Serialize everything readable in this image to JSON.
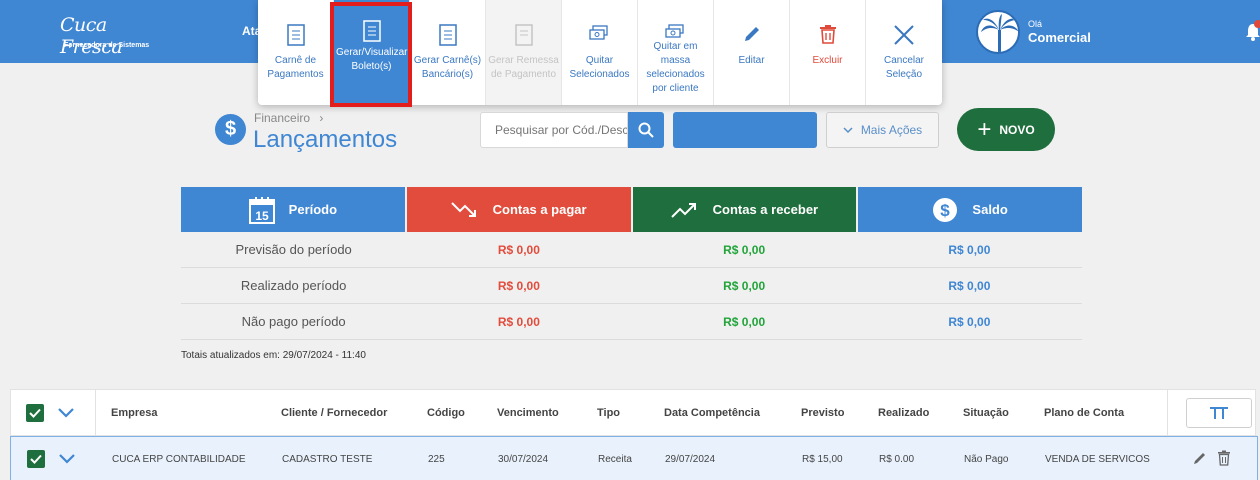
{
  "header": {
    "logo_text": "Cuca Fresca",
    "logo_subtitle": "Fornecedora de Sistemas",
    "nav_partial": "Ata",
    "user_greeting": "Olá",
    "user_name": "Comercial",
    "brand_color": "#3f86d3"
  },
  "actions_menu": {
    "items": [
      {
        "label": "Carnê de Pagamentos",
        "icon": "document-icon",
        "state": "normal"
      },
      {
        "label": "Gerar/Visualizar Boleto(s)",
        "icon": "document-icon",
        "state": "highlighted"
      },
      {
        "label": "Gerar Carnê(s) Bancário(s)",
        "icon": "document-icon",
        "state": "normal"
      },
      {
        "label": "Gerar Remessa de Pagamento",
        "icon": "document-icon",
        "state": "disabled"
      },
      {
        "label": "Quitar Selecionados",
        "icon": "money-icon",
        "state": "normal"
      },
      {
        "label": "Quitar em massa selecionados por cliente",
        "icon": "money-icon",
        "state": "normal"
      },
      {
        "label": "Editar",
        "icon": "pencil-icon",
        "state": "normal"
      },
      {
        "label": "Excluir",
        "icon": "trash-icon",
        "state": "danger"
      },
      {
        "label": "Cancelar Seleção",
        "icon": "close-icon",
        "state": "normal"
      }
    ]
  },
  "page": {
    "breadcrumb": "Financeiro",
    "breadcrumb_sep": "›",
    "title": "Lançamentos",
    "search_placeholder": "Pesquisar por Cód./Desc",
    "more_actions_label": "Mais Ações",
    "new_label": "NOVO"
  },
  "summary": {
    "headers": {
      "periodo": "Período",
      "periodo_day": "15",
      "pagar": "Contas a pagar",
      "receber": "Contas a receber",
      "saldo": "Saldo"
    },
    "rows": [
      {
        "label": "Previsão do período",
        "pagar": "R$ 0,00",
        "receber": "R$ 0,00",
        "saldo": "R$ 0,00"
      },
      {
        "label": "Realizado período",
        "pagar": "R$ 0,00",
        "receber": "R$ 0,00",
        "saldo": "R$ 0,00"
      },
      {
        "label": "Não pago período",
        "pagar": "R$ 0,00",
        "receber": "R$ 0,00",
        "saldo": "R$ 0,00"
      }
    ],
    "totals_note": "Totais atualizados em: 29/07/2024 - 11:40"
  },
  "table": {
    "columns": [
      "Empresa",
      "Cliente / Fornecedor",
      "Código",
      "Vencimento",
      "Tipo",
      "Data Competência",
      "Previsto",
      "Realizado",
      "Situação",
      "Plano de Conta"
    ],
    "rows": [
      [
        "CUCA ERP CONTABILIDADE",
        "CADASTRO TESTE",
        "225",
        "30/07/2024",
        "Receita",
        "29/07/2024",
        "R$ 15,00",
        "R$ 0.00",
        "Não Pago",
        "VENDA DE SERVICOS"
      ]
    ]
  }
}
